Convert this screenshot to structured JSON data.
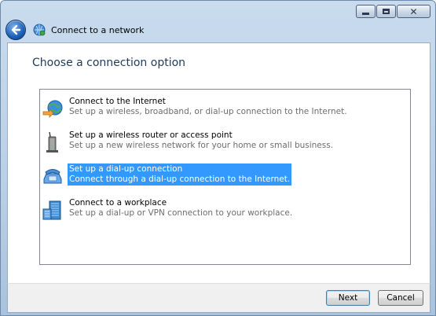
{
  "window": {
    "title": "Connect to a network",
    "caption_buttons": [
      "minimize",
      "maximize",
      "close"
    ]
  },
  "page": {
    "heading": "Choose a connection option"
  },
  "options": [
    {
      "title": "Connect to the Internet",
      "description": "Set up a wireless, broadband, or dial-up connection to the Internet.",
      "icon": "globe-network-icon",
      "selected": false
    },
    {
      "title": "Set up a wireless router or access point",
      "description": "Set up a new wireless network for your home or small business.",
      "icon": "wireless-router-icon",
      "selected": false
    },
    {
      "title": "Set up a dial-up connection",
      "description": "Connect through a dial-up connection to the Internet.",
      "icon": "telephone-modem-icon",
      "selected": true
    },
    {
      "title": "Connect to a workplace",
      "description": "Set up a dial-up or VPN connection to your workplace.",
      "icon": "workplace-building-icon",
      "selected": false
    }
  ],
  "buttons": {
    "next": "Next",
    "cancel": "Cancel"
  },
  "colors": {
    "selection": "#3399ff",
    "heading": "#1e395b",
    "description": "#6d6d6d"
  }
}
